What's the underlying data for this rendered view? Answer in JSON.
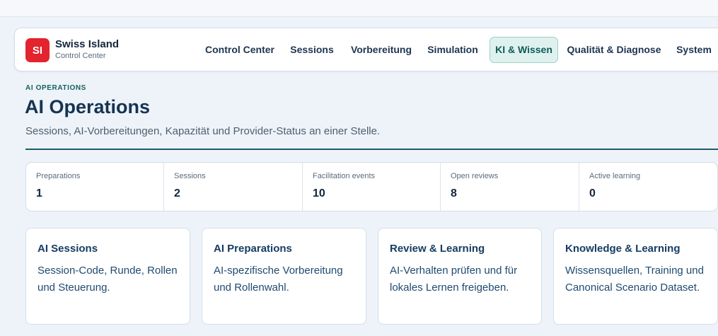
{
  "brand": {
    "logo": "SI",
    "name": "Swiss Island",
    "subtitle": "Control Center"
  },
  "nav": [
    {
      "label": "Control Center",
      "active": false
    },
    {
      "label": "Sessions",
      "active": false
    },
    {
      "label": "Vorbereitung",
      "active": false
    },
    {
      "label": "Simulation",
      "active": false
    },
    {
      "label": "KI & Wissen",
      "active": true
    },
    {
      "label": "Qualität & Diagnose",
      "active": false
    },
    {
      "label": "System",
      "active": false
    }
  ],
  "header": {
    "eyebrow": "AI OPERATIONS",
    "title": "AI Operations",
    "description": "Sessions, AI-Vorbereitungen, Kapazität und Provider-Status an einer Stelle."
  },
  "stats": [
    {
      "label": "Preparations",
      "value": "1"
    },
    {
      "label": "Sessions",
      "value": "2"
    },
    {
      "label": "Facilitation events",
      "value": "10"
    },
    {
      "label": "Open reviews",
      "value": "8"
    },
    {
      "label": "Active learning",
      "value": "0"
    }
  ],
  "cards": [
    {
      "title": "AI Sessions",
      "description": "Session-Code, Runde, Rollen und Steuerung."
    },
    {
      "title": "AI Preparations",
      "description": "AI-spezifische Vorbereitung und Rollenwahl."
    },
    {
      "title": "Review & Learning",
      "description": "AI-Verhalten prüfen und für lokales Lernen freigeben."
    },
    {
      "title": "Knowledge & Learning",
      "description": "Wissensquellen, Training und Canonical Scenario Dataset."
    }
  ],
  "colors": {
    "brand_red": "#e3232d",
    "accent_teal": "#1c5e66",
    "active_tab_bg": "#dff1ee"
  }
}
